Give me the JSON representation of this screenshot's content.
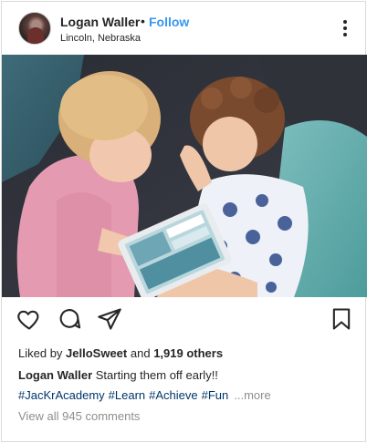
{
  "post": {
    "username": "Logan Waller",
    "separator": "•",
    "follow_label": "Follow",
    "location": "Lincoln, Nebraska"
  },
  "image": {
    "alt": "Two toddlers looking at a tablet on a couch"
  },
  "likes": {
    "prefix": "Liked by",
    "liker": "JelloSweet",
    "joiner": "and",
    "count": "1,919 others"
  },
  "caption": {
    "author": "Logan Waller",
    "text": "Starting them off early!!"
  },
  "hashtags": [
    "#JacKrAcademy",
    "#Learn",
    "#Achieve",
    "#Fun"
  ],
  "more_label": "...more",
  "comments_label": "View all 945 comments",
  "icons": {
    "like": "heart-icon",
    "comment": "comment-bubble-icon",
    "share": "paper-plane-icon",
    "save": "bookmark-icon",
    "options": "more-options-icon"
  },
  "colors": {
    "accent": "#3897f0",
    "hashtag": "#003569",
    "muted": "#8e8e8e",
    "text": "#262626"
  }
}
